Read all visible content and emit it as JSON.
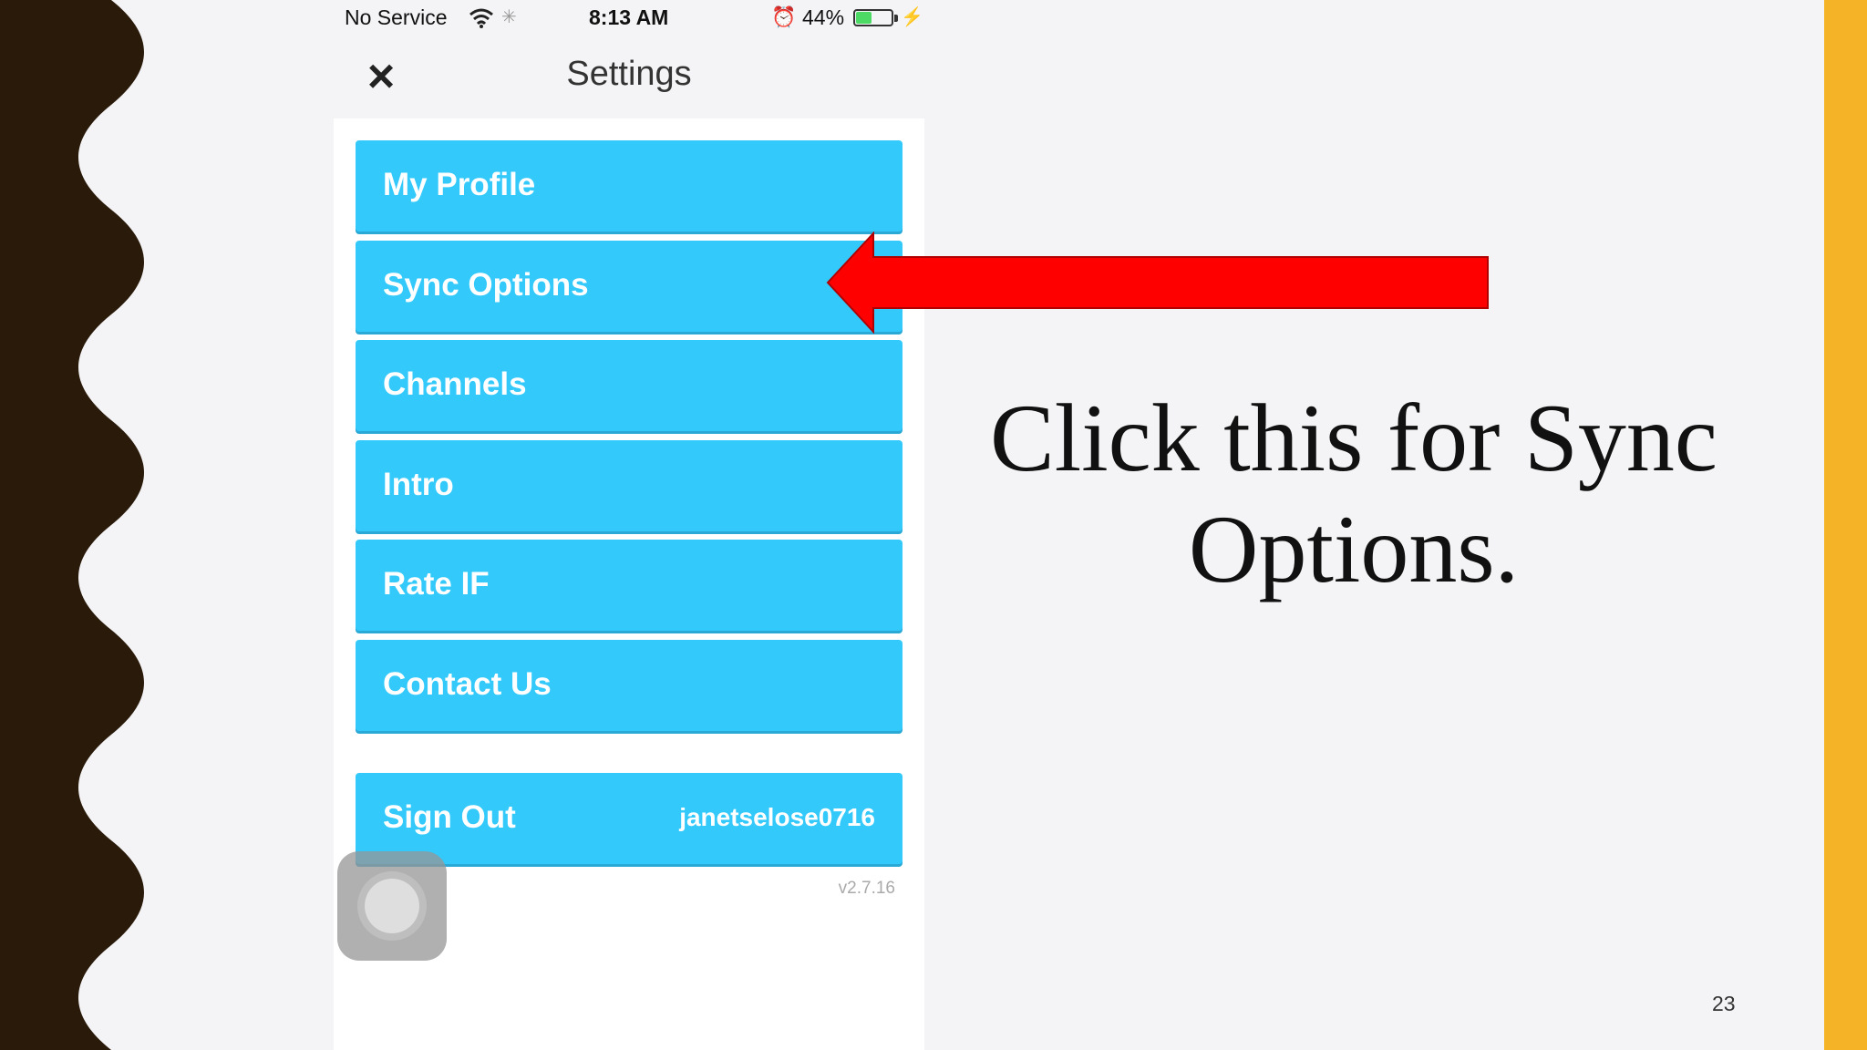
{
  "status_bar": {
    "carrier": "No Service",
    "time": "8:13 AM",
    "battery_percent": "44%",
    "battery_level": 0.44,
    "icons": [
      "wifi-icon",
      "activity-spinner-icon",
      "alarm-icon",
      "battery-icon",
      "charging-bolt-icon"
    ]
  },
  "header": {
    "title": "Settings",
    "close_icon": "×"
  },
  "menu": {
    "items": [
      {
        "label": "My Profile"
      },
      {
        "label": "Sync Options"
      },
      {
        "label": "Channels"
      },
      {
        "label": "Intro"
      },
      {
        "label": "Rate IF"
      },
      {
        "label": "Contact Us"
      }
    ],
    "sign_out": {
      "label": "Sign Out",
      "username": "janetselose0716"
    },
    "version": "v2.7.16"
  },
  "annotation": {
    "text": "Click this for Sync Options.",
    "arrow_color": "#ff0000"
  },
  "slide": {
    "page_number": "23",
    "accent_color": "#f5b427",
    "border_color": "#2a1a0a",
    "button_color": "#33c9fb"
  }
}
